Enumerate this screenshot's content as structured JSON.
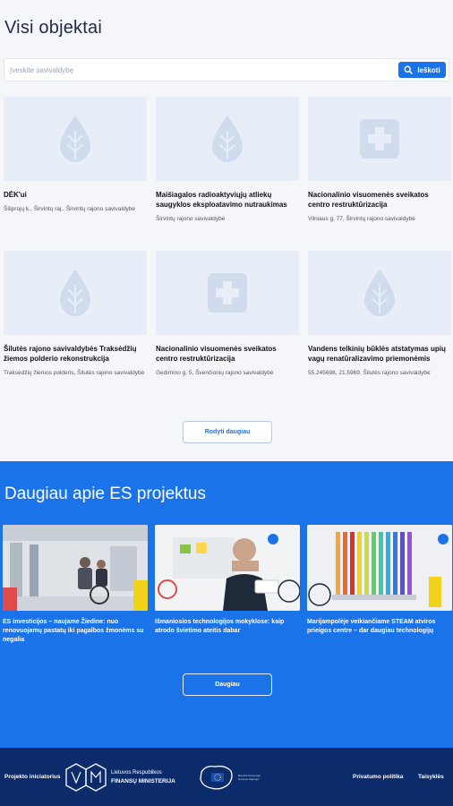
{
  "page_title": "Visi objektai",
  "search": {
    "placeholder": "Įveskite savivaldybę",
    "button_label": "Ieškoti"
  },
  "objects": [
    {
      "title": "DĖK'ui",
      "address": "Šiliprojų k., Širvintų raj., Širvintų rajono savivaldybė",
      "icon": "water-drop-icon"
    },
    {
      "title": "Maišiagalos radioaktyviųjų atliekų saugyklos eksploatavimo nutraukimas",
      "address": "Širvintų rajono savivaldybė",
      "icon": "water-drop-icon"
    },
    {
      "title": "Nacionalinio visuomenės sveikatos centro restruktūrizacija",
      "address": "Vilniaus g. 77, Širvintų rajono savivaldybė",
      "icon": "medical-cross-icon"
    },
    {
      "title": "Šilutės rajono savivaldybės Traksėdžių žiemos polderio rekonstrukcija",
      "address": "Traksėdžių žiemos polderis, Šilutės rajono savivaldybė",
      "icon": "water-drop-icon"
    },
    {
      "title": "Nacionalinio visuomenės sveikatos centro restruktūrizacija",
      "address": "Gedimino g. 5, Švenčionių rajono savivaldybė",
      "icon": "medical-cross-icon"
    },
    {
      "title": "Vandens telkinių būklės atstatymas upių vagų renatūralizavimo priemonėmis",
      "address": "55.245698, 21.5969, Šilutės rajono savivaldybė",
      "icon": "water-drop-icon"
    }
  ],
  "show_more_label": "Rodyti daugiau",
  "eu_section": {
    "title": "Daugiau apie ES projektus",
    "news": [
      {
        "title": "ES investicijos – naujame Žiedine: nuo renovuojamų pastatų iki pagalbos žmonėms su negalia"
      },
      {
        "title": "Išmaniosios technologijos mokyklose: kaip atrodo švietimo ateitis dabar"
      },
      {
        "title": "Marijampolėje veikiančiame STEAM atviros prieigos centre – dar daugiau technologijų"
      }
    ],
    "button_label": "Daugiau"
  },
  "footer": {
    "initiator_label": "Projekto iniciatorius",
    "ministry_line1": "Lietuvos Respublikos",
    "ministry_line2": "FINANSŲ MINISTERIJA",
    "eu_logo_text": "Bendrai finansuoja Europos Sąjunga",
    "privacy_link": "Privatumo politika",
    "rules_link": "Taisyklės"
  },
  "colors": {
    "accent": "#1a73e8",
    "footer": "#0b2b6b",
    "placeholder_bg": "#e8eef8",
    "placeholder_icon": "#d0dbee"
  }
}
